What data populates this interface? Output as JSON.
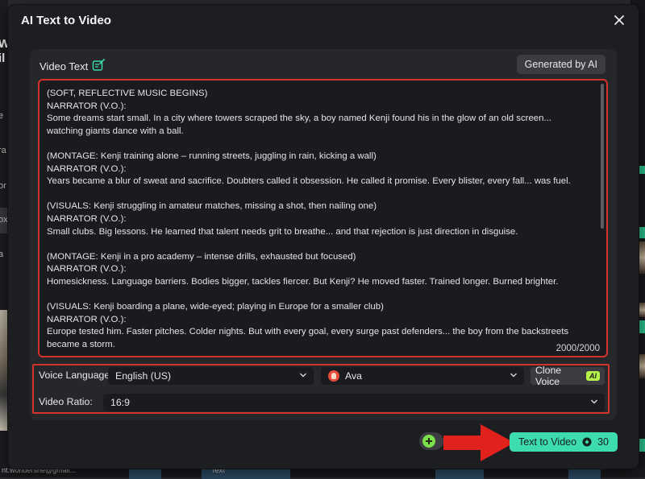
{
  "background": {
    "left_fragments": [
      "W",
      "il",
      "e",
      "ra",
      "or",
      "ox",
      "a"
    ],
    "bottom_email": "nt.wondershe@gmail...",
    "bottom_tile_label": "Text"
  },
  "dialog": {
    "title": "AI Text to Video",
    "close_icon": "close-x-icon"
  },
  "video_text": {
    "label": "Video Text",
    "label_icon": "edit-note-icon",
    "generated_button": "Generated by AI",
    "script_lines": [
      "(SOFT, REFLECTIVE MUSIC BEGINS)",
      "NARRATOR (V.O.):",
      "Some dreams start small. In a city where towers scraped the sky, a boy named Kenji found his in the glow of an old screen...",
      "watching giants dance with a ball.",
      "",
      "(MONTAGE: Kenji training alone – running streets, juggling in rain, kicking a wall)",
      "NARRATOR (V.O.):",
      "Years became a blur of sweat and sacrifice. Doubters called it obsession. He called it promise. Every blister, every fall... was fuel.",
      "",
      "(VISUALS: Kenji struggling in amateur matches, missing a shot, then nailing one)",
      "NARRATOR (V.O.):",
      "Small clubs. Big lessons. He learned that talent needs grit to breathe... and that rejection is just direction in disguise.",
      "",
      "(MONTAGE: Kenji in a pro academy – intense drills, exhausted but focused)",
      "NARRATOR (V.O.):",
      "Homesickness. Language barriers. Bodies bigger, tackles fiercer. But Kenji? He moved faster. Trained longer. Burned brighter.",
      "",
      "(VISUALS: Kenji boarding a plane, wide-eyed; playing in Europe for a smaller club)",
      "NARRATOR (V.O.):",
      "Europe tested him. Faster pitches. Colder nights. But with every goal, every surge past defenders... the boy from the backstreets",
      "became a storm."
    ],
    "char_count": "2000/2000"
  },
  "voice": {
    "language_label": "Voice Language:",
    "language_value": "English (US)",
    "voice_value": "Ava",
    "clone_label": "Clone Voice",
    "ai_badge": "AI",
    "ratio_label": "Video Ratio:",
    "ratio_value": "16:9"
  },
  "footer": {
    "generate_label": "Text to Video",
    "credits": "30",
    "credit_icon": "coin-icon",
    "plus_icon": "plus-circle-icon"
  },
  "colors": {
    "accent": "#3ddbb0",
    "highlight_border": "#d6312c",
    "arrow": "#e0211c",
    "ai_badge": "#b5f24a"
  }
}
